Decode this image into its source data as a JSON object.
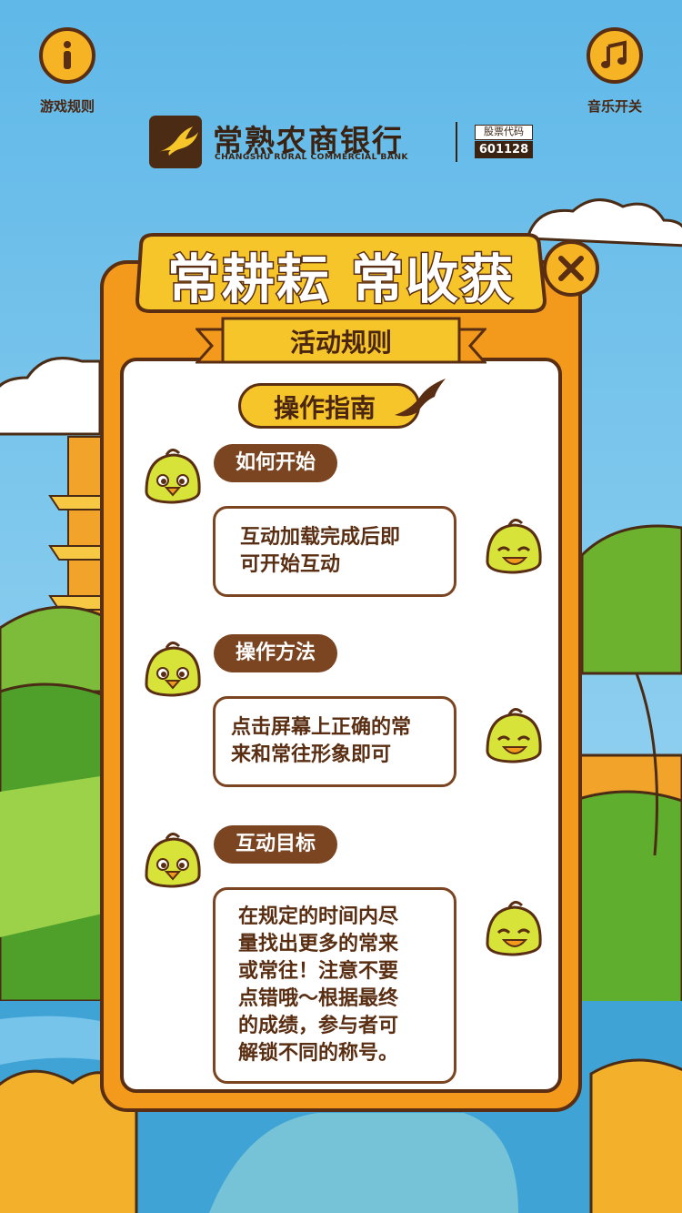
{
  "header": {
    "rules_label": "游戏规则",
    "music_label": "音乐开关",
    "rules_icon": "info-icon",
    "music_icon": "music-note-icon"
  },
  "bank": {
    "name_cn": "常熟农商银行",
    "name_en": "CHANGSHU RURAL COMMERCIAL BANK",
    "stock_label": "股票代码",
    "stock_code": "601128"
  },
  "modal": {
    "title": "常耕耘 常收获",
    "ribbon": "活动规则",
    "guide_title": "操作指南",
    "sections": [
      {
        "tag": "如何开始",
        "text": "互动加载完成后即\n可开始互动"
      },
      {
        "tag": "操作方法",
        "text": "点击屏幕上正确的常\n来和常往形象即可"
      },
      {
        "tag": "互动目标",
        "text": "在规定的时间内尽\n量找出更多的常来\n或常往！注意不要\n点错哦～根据最终\n的成绩，参与者可\n解锁不同的称号。"
      }
    ]
  },
  "colors": {
    "sky": "#6cc0ea",
    "modal_orange": "#f39a1c",
    "accent_yellow": "#f6c52a",
    "brown": "#5a2e12",
    "tag_brown": "#7a4520"
  }
}
